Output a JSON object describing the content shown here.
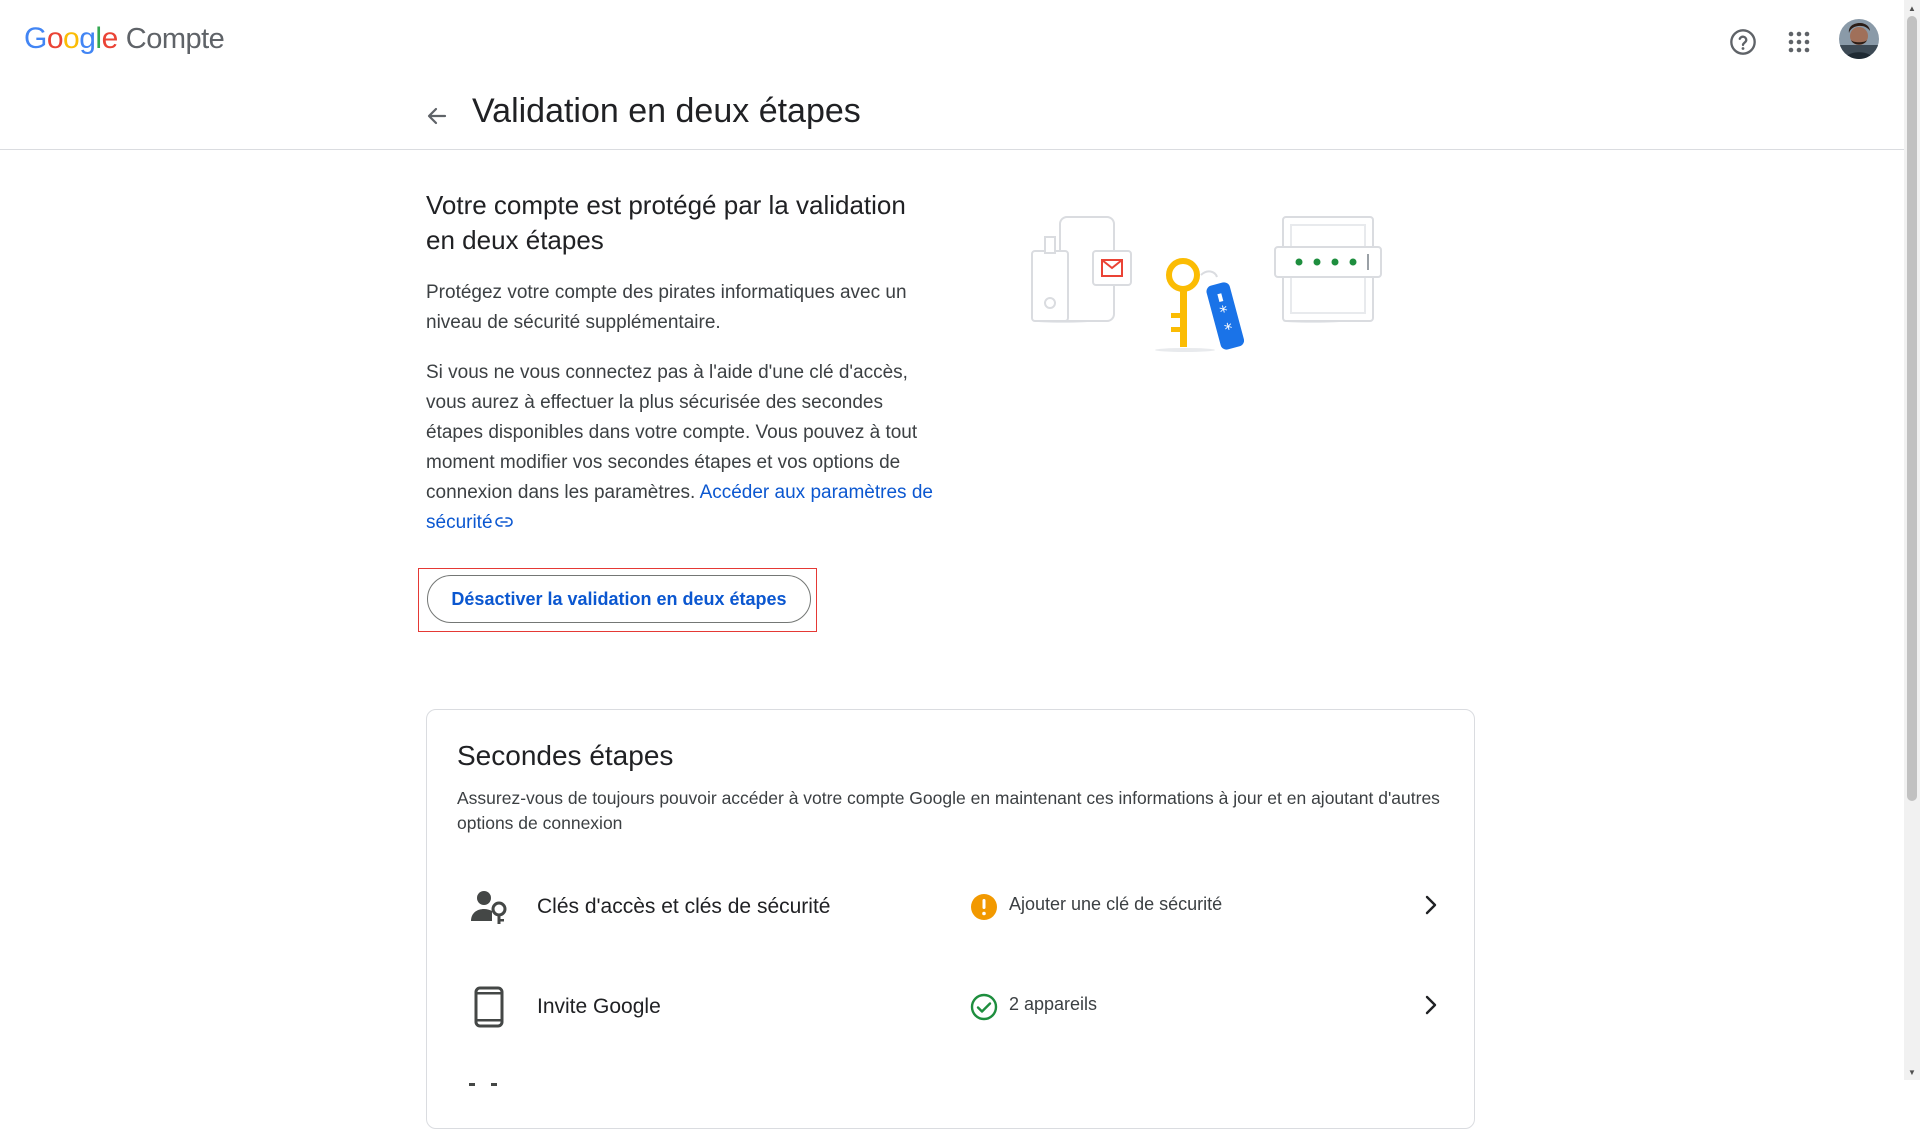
{
  "header": {
    "logo_letters": [
      "G",
      "o",
      "o",
      "g",
      "l",
      "e"
    ],
    "logo_colors": [
      "#4285F4",
      "#EA4335",
      "#FBBC05",
      "#4285F4",
      "#34A853",
      "#EA4335"
    ],
    "product": "Compte",
    "icons": [
      "help-icon",
      "apps-icon"
    ]
  },
  "page": {
    "title": "Validation en deux étapes"
  },
  "intro": {
    "heading": "Votre compte est protégé par la validation en deux étapes",
    "para1": "Protégez votre compte des pirates informatiques avec un niveau de sécurité supplémentaire.",
    "para2": "Si vous ne vous connectez pas à l'aide d'une clé d'accès, vous aurez à effectuer la plus sécurisée des secondes étapes disponibles dans votre compte. Vous pouvez à tout moment modifier vos secondes étapes et vos options de connexion dans les paramètres.",
    "link": "Accéder aux paramètres de sécurité",
    "button": "Désactiver la validation en deux étapes"
  },
  "second_steps": {
    "title": "Secondes étapes",
    "description": "Assurez-vous de toujours pouvoir accéder à votre compte Google en maintenant ces informations à jour et en ajoutant d'autres options de connexion",
    "items": [
      {
        "label": "Clés d'accès et clés de sécurité",
        "status": "Ajouter une clé de sécurité",
        "status_type": "warning",
        "icon": "passkey-icon"
      },
      {
        "label": "Invite Google",
        "status": "2 appareils",
        "status_type": "ok",
        "icon": "phone-icon"
      }
    ]
  },
  "colors": {
    "accent": "#0b57d0",
    "warning": "#f29900",
    "success": "#1e8e3e",
    "highlight_border": "#e53935"
  }
}
